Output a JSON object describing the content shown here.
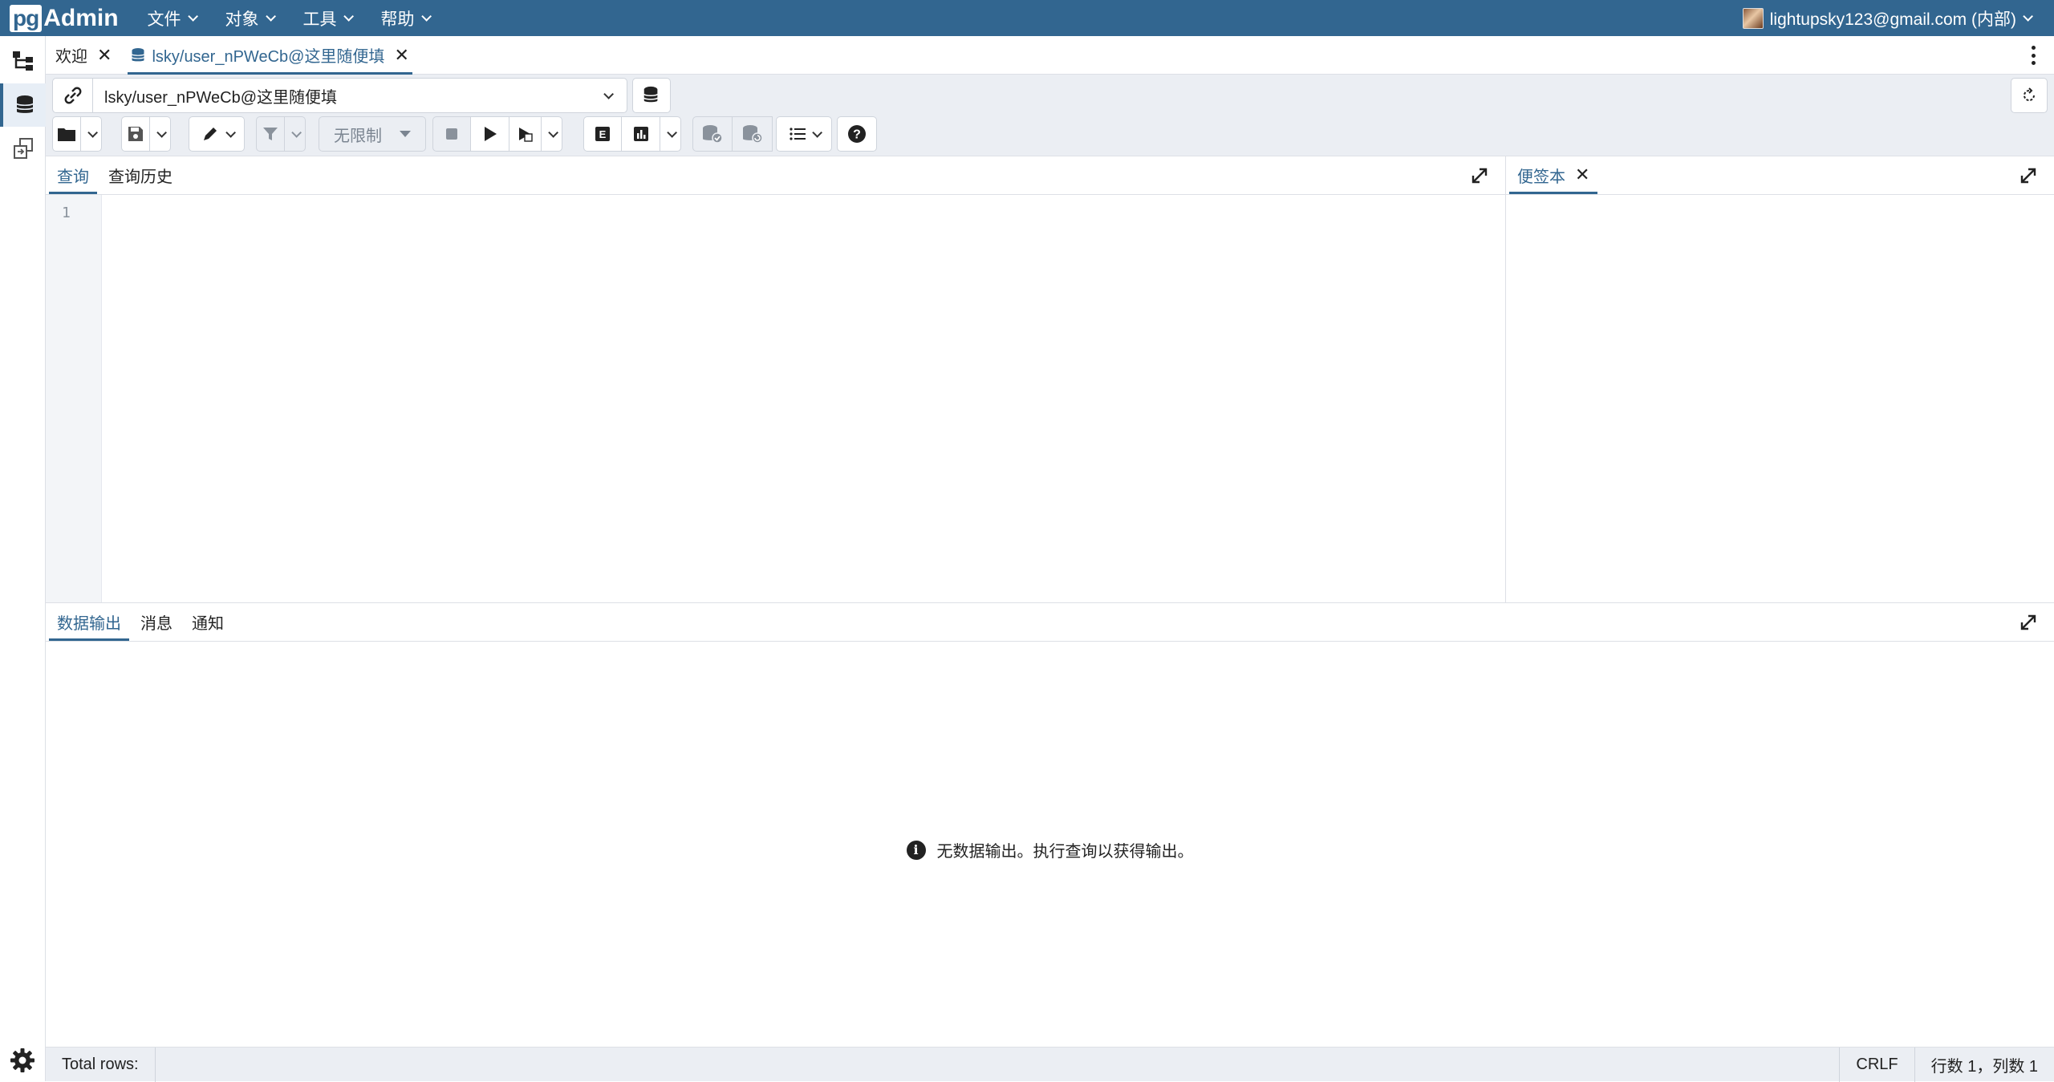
{
  "app": {
    "logo_pg": "pg",
    "logo_admin": "Admin"
  },
  "menu": {
    "file": "文件",
    "object": "对象",
    "tools": "工具",
    "help": "帮助"
  },
  "user": {
    "email": "lightupsky123@gmail.com (内部)"
  },
  "tabs": {
    "welcome": "欢迎",
    "query_tool": "lsky/user_nPWeCb@这里随便填"
  },
  "connection": {
    "selected": "lsky/user_nPWeCb@这里随便填"
  },
  "toolbar": {
    "limit": "无限制"
  },
  "editor": {
    "tab_query": "查询",
    "tab_history": "查询历史",
    "line_number": "1"
  },
  "scratchpad": {
    "tab_label": "便签本"
  },
  "results": {
    "tab_data": "数据输出",
    "tab_messages": "消息",
    "tab_notifications": "通知",
    "empty_message": "无数据输出。执行查询以获得输出。"
  },
  "status": {
    "total_rows": "Total rows:",
    "line_ending": "CRLF",
    "cursor_position": "行数 1，列数 1"
  },
  "colors": {
    "navbar": "#326690",
    "accent": "#326690",
    "toolbar_bg": "#ebeef3"
  }
}
